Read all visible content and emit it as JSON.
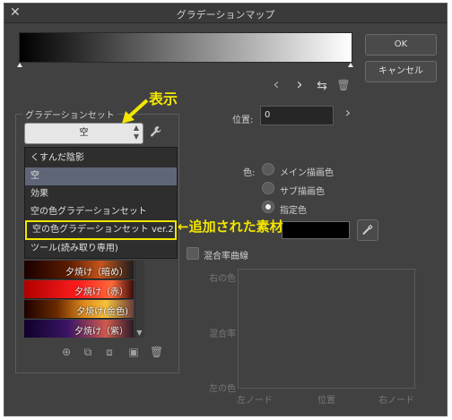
{
  "window": {
    "title": "グラデーションマップ",
    "close_glyph": "✕"
  },
  "buttons": {
    "ok": "OK",
    "cancel": "キャンセル"
  },
  "node_toolbar": {
    "prev_icon": "‹",
    "next_icon": "›",
    "flip_icon": "⇆",
    "delete_icon": "🗑"
  },
  "position": {
    "label": "位置:",
    "value": "0",
    "arrow": "›"
  },
  "gradient_set": {
    "group_title": "グラデーションセット",
    "selected": "空",
    "dropdown_items": [
      "くすんだ陰影",
      "空",
      "効果",
      "空の色グラデーションセット",
      "空の色グラデーションセット ver.2",
      "ツール(読み取り専用)"
    ],
    "selected_index": 1,
    "highlighted_index": 4,
    "gradients": [
      {
        "label": "夕焼け（暗め）",
        "gradient": "linear-gradient(to right,#1a0000,#5a1b00 40%,#c5561b 70%,#1d1d1d)"
      },
      {
        "label": "夕焼け（赤）",
        "gradient": "linear-gradient(to right,#b00000,#ff1d1d 50%,#ff6a3a 80%,#3b0a0a)"
      },
      {
        "label": "夕焼け(金色)",
        "gradient": "linear-gradient(to right,#1b0000,#6b2a00 30%,#e08a1c 55%,#f7c23a 75%,#6a3c3c)"
      },
      {
        "label": "夕焼け（紫）",
        "gradient": "linear-gradient(to right,#10002a,#3b1566 40%,#d05a4e 75%,#2a1a2a)"
      }
    ],
    "bottom_icons": [
      "add-icon",
      "new-set-icon",
      "duplicate-icon",
      "register-icon",
      "delete-icon"
    ]
  },
  "color": {
    "label": "色:",
    "options": [
      "メイン描画色",
      "サブ描画色",
      "指定色"
    ],
    "checked_index": 2,
    "swatch_color": "#000000"
  },
  "blend_curve": {
    "checkbox_label": "混合率曲線",
    "y_labels": [
      "右の色",
      "混合率",
      "左の色"
    ],
    "x_labels": [
      "左ノード",
      "位置",
      "右ノード"
    ]
  },
  "annotations": {
    "show": "表示",
    "added": "←追加された素材"
  }
}
